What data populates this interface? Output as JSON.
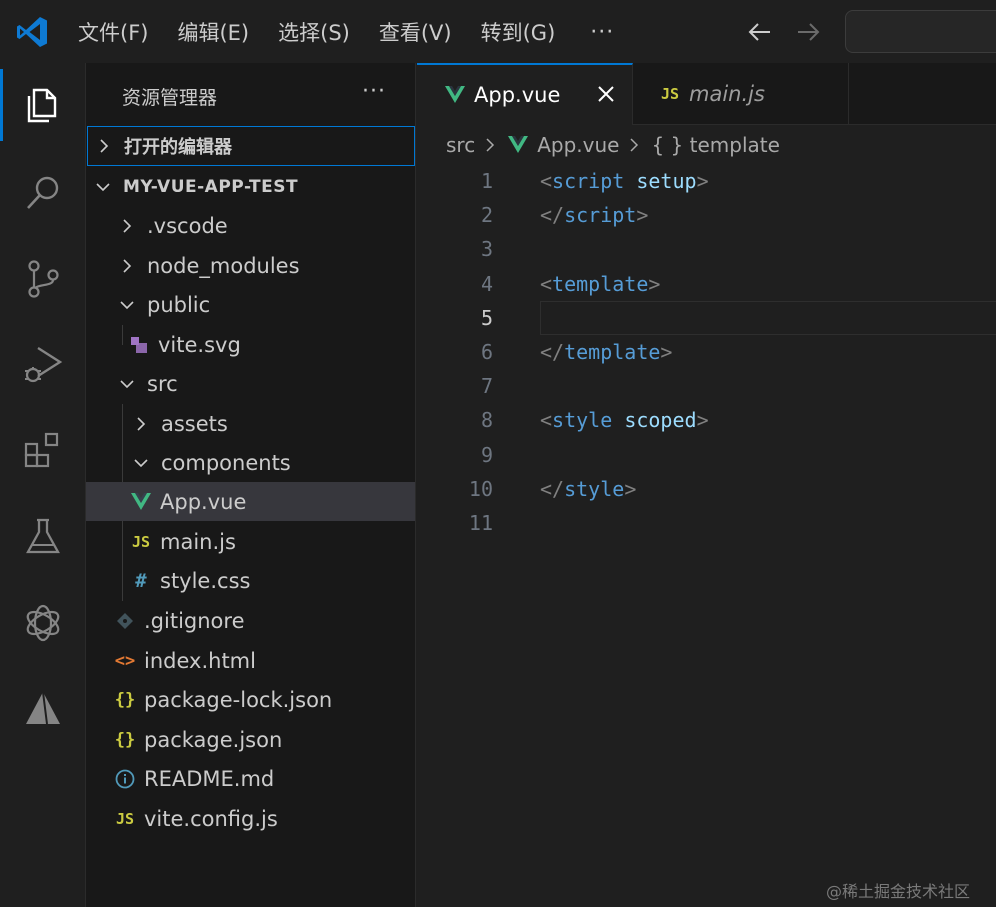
{
  "menu": {
    "items": [
      "文件(F)",
      "编辑(E)",
      "选择(S)",
      "查看(V)",
      "转到(G)"
    ],
    "more": "···"
  },
  "activity_bar": {
    "items": [
      "explorer-icon",
      "search-icon",
      "source-control-icon",
      "run-debug-icon",
      "extensions-icon",
      "testing-icon",
      "openai-icon",
      "remote-pyramid-icon"
    ],
    "active": "explorer-icon"
  },
  "sidebar": {
    "title": "资源管理器",
    "more": "···",
    "open_editors": "打开的编辑器",
    "project": "MY-VUE-APP-TEST",
    "tree": [
      {
        "name": ".vscode",
        "type": "folder",
        "expanded": false
      },
      {
        "name": "node_modules",
        "type": "folder",
        "expanded": false
      },
      {
        "name": "public",
        "type": "folder",
        "expanded": true
      },
      {
        "name": "vite.svg",
        "type": "svg"
      },
      {
        "name": "src",
        "type": "folder",
        "expanded": true
      },
      {
        "name": "assets",
        "type": "folder",
        "expanded": false
      },
      {
        "name": "components",
        "type": "folder",
        "expanded": true
      },
      {
        "name": "App.vue",
        "type": "vue",
        "selected": true
      },
      {
        "name": "main.js",
        "type": "js"
      },
      {
        "name": "style.css",
        "type": "css"
      },
      {
        "name": ".gitignore",
        "type": "git"
      },
      {
        "name": "index.html",
        "type": "html"
      },
      {
        "name": "package-lock.json",
        "type": "json"
      },
      {
        "name": "package.json",
        "type": "json"
      },
      {
        "name": "README.md",
        "type": "info"
      },
      {
        "name": "vite.config.js",
        "type": "js"
      }
    ]
  },
  "editor": {
    "tabs": [
      {
        "label": "App.vue",
        "active": true
      },
      {
        "label": "main.js",
        "active": false
      }
    ],
    "breadcrumb": [
      "src",
      "App.vue",
      "{ } template"
    ],
    "current_line": 5,
    "lines": [
      {
        "n": "1",
        "tokens": [
          [
            "punc",
            "<"
          ],
          [
            "tag",
            "script"
          ],
          [
            "plain",
            " "
          ],
          [
            "attr",
            "setup"
          ],
          [
            "punc",
            ">"
          ]
        ]
      },
      {
        "n": "2",
        "tokens": [
          [
            "punc",
            "</"
          ],
          [
            "tag",
            "script"
          ],
          [
            "punc",
            ">"
          ]
        ]
      },
      {
        "n": "3",
        "tokens": []
      },
      {
        "n": "4",
        "tokens": [
          [
            "punc",
            "<"
          ],
          [
            "tag",
            "template"
          ],
          [
            "punc",
            ">"
          ]
        ]
      },
      {
        "n": "5",
        "tokens": []
      },
      {
        "n": "6",
        "tokens": [
          [
            "punc",
            "</"
          ],
          [
            "tag",
            "template"
          ],
          [
            "punc",
            ">"
          ]
        ]
      },
      {
        "n": "7",
        "tokens": []
      },
      {
        "n": "8",
        "tokens": [
          [
            "punc",
            "<"
          ],
          [
            "tag",
            "style"
          ],
          [
            "plain",
            " "
          ],
          [
            "attr",
            "scoped"
          ],
          [
            "punc",
            ">"
          ]
        ]
      },
      {
        "n": "9",
        "tokens": []
      },
      {
        "n": "10",
        "tokens": [
          [
            "punc",
            "</"
          ],
          [
            "tag",
            "style"
          ],
          [
            "punc",
            ">"
          ]
        ]
      },
      {
        "n": "11",
        "tokens": []
      }
    ]
  },
  "colors": {
    "accent": "#0078d4",
    "vue": "#41b883",
    "js": "#cbcb41",
    "css": "#519aba",
    "html": "#e37933",
    "json": "#cbcb41",
    "svg": "#a074c4"
  },
  "watermark": "@稀土掘金技术社区"
}
